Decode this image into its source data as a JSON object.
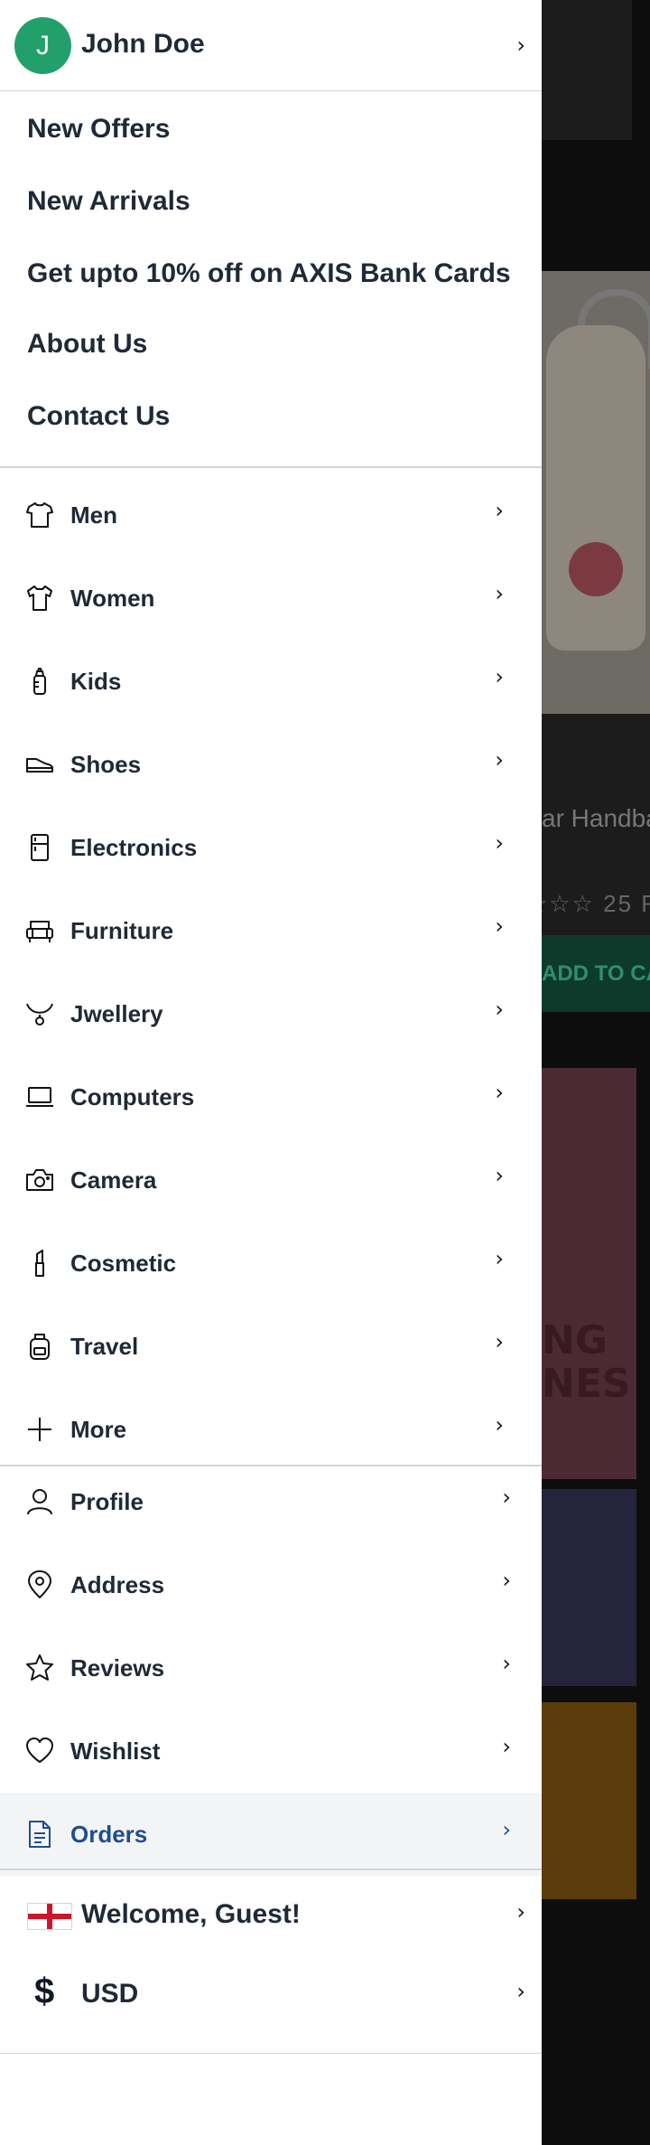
{
  "user": {
    "initial": "J",
    "name": "John Doe"
  },
  "links": [
    "New Offers",
    "New Arrivals",
    "Get upto 10% off on AXIS Bank Cards",
    "About Us",
    "Contact Us"
  ],
  "categories": [
    {
      "label": "Men",
      "icon": "shirt-icon"
    },
    {
      "label": "Women",
      "icon": "dress-icon"
    },
    {
      "label": "Kids",
      "icon": "baby-bottle-icon"
    },
    {
      "label": "Shoes",
      "icon": "shoe-icon"
    },
    {
      "label": "Electronics",
      "icon": "fridge-icon"
    },
    {
      "label": "Furniture",
      "icon": "sofa-icon"
    },
    {
      "label": "Jwellery",
      "icon": "necklace-icon"
    },
    {
      "label": "Computers",
      "icon": "laptop-icon"
    },
    {
      "label": "Camera",
      "icon": "camera-icon"
    },
    {
      "label": "Cosmetic",
      "icon": "lipstick-icon"
    },
    {
      "label": "Travel",
      "icon": "backpack-icon"
    },
    {
      "label": "More",
      "icon": "plus-icon"
    }
  ],
  "account": [
    {
      "label": "Profile",
      "icon": "user-icon"
    },
    {
      "label": "Address",
      "icon": "location-pin-icon"
    },
    {
      "label": "Reviews",
      "icon": "star-icon"
    },
    {
      "label": "Wishlist",
      "icon": "heart-icon"
    },
    {
      "label": "Orders",
      "icon": "document-icon",
      "active": true
    }
  ],
  "bottom": {
    "welcome": "Welcome, Guest!",
    "currency": "USD",
    "currency_symbol": "$"
  },
  "background": {
    "product_title": "ar Handba",
    "rating_count": "25 R",
    "add_to_cart": "ADD TO CA",
    "banner_text": "NG\nNES"
  },
  "colors": {
    "avatar": "#22a06b",
    "active_text": "#1e4e8c",
    "active_bg": "#f3f4f6",
    "flag_red": "#cf142b"
  }
}
